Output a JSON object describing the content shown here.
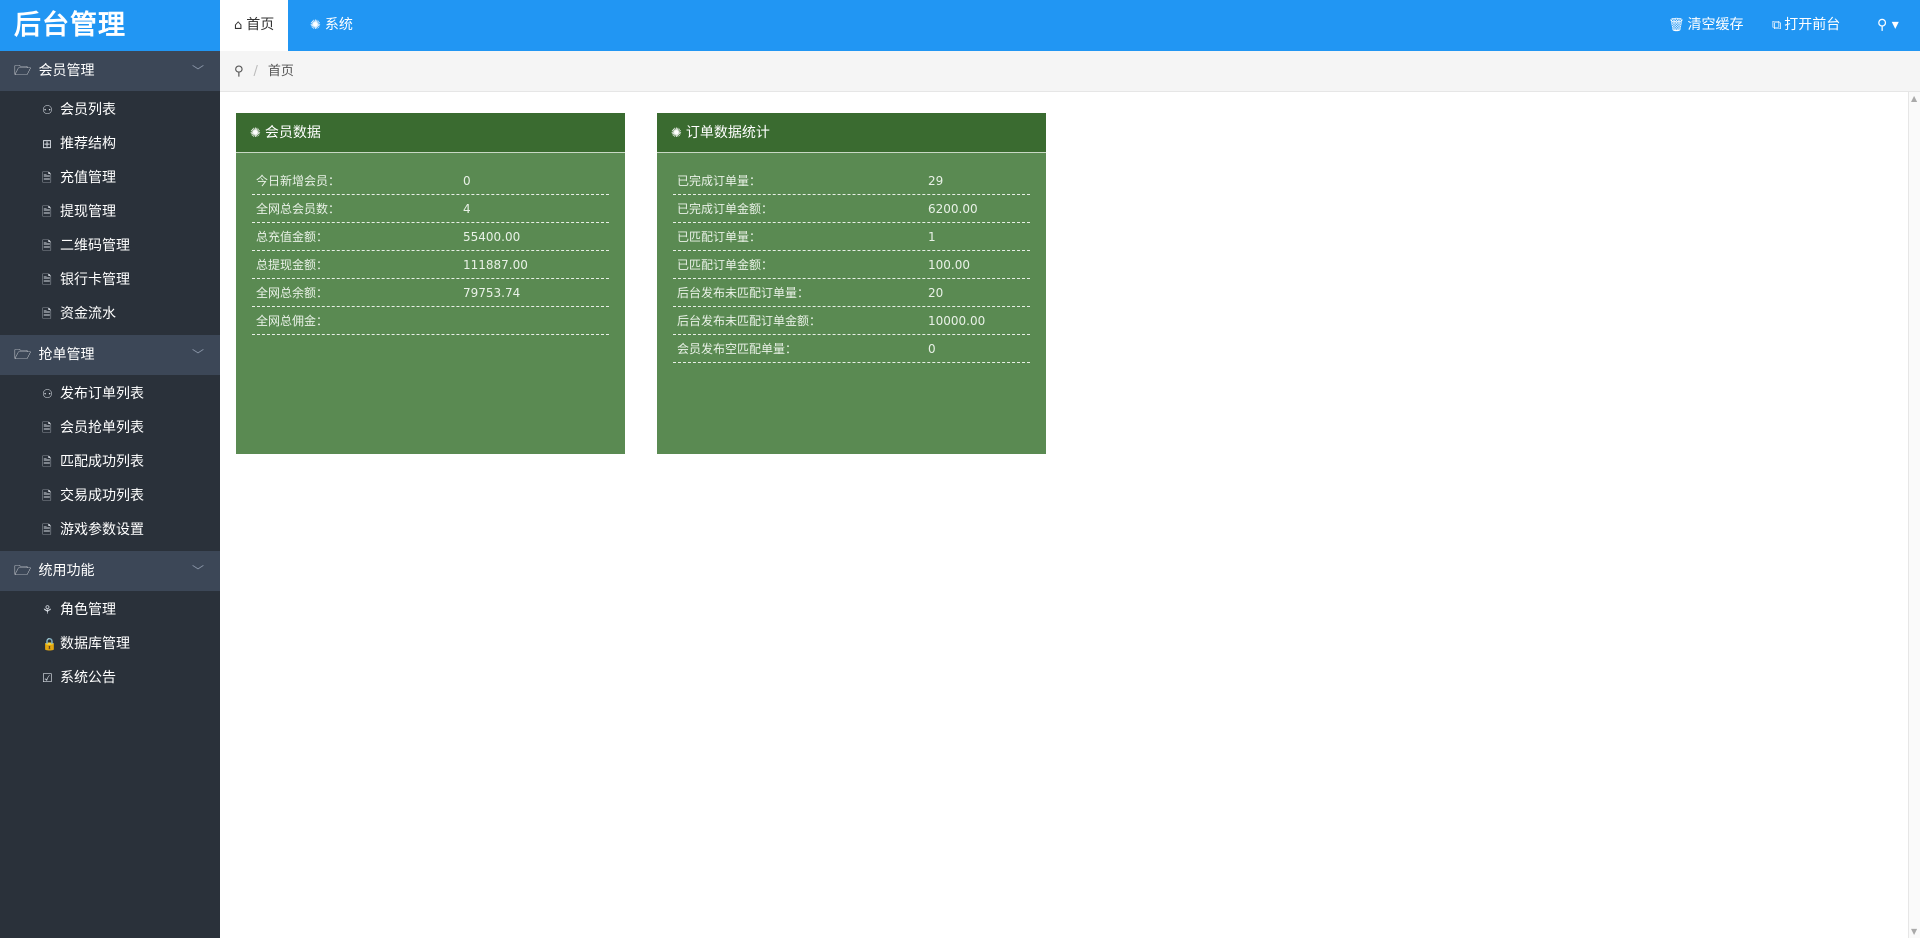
{
  "brand": "后台管理",
  "topbar": {
    "tabs": [
      {
        "icon": "home-icon",
        "glyph": "⌂",
        "label": "首页"
      },
      {
        "icon": "gear-icon",
        "glyph": "✺",
        "label": "系统"
      }
    ],
    "clear_cache": "清空缓存",
    "open_frontend": "打开前台",
    "user_glyph": "⚲ ▾"
  },
  "breadcrumb": {
    "icon": "location-icon",
    "glyph": "⚲",
    "separator": "/",
    "current": "首页"
  },
  "sidebar": {
    "groups": [
      {
        "title": "会员管理",
        "items": [
          {
            "label": "会员列表",
            "icon": "user-icon",
            "glyph": "⚇"
          },
          {
            "label": "推荐结构",
            "icon": "grid-icon",
            "glyph": "⊞"
          },
          {
            "label": "充值管理",
            "icon": "document-icon",
            "glyph": "🗎"
          },
          {
            "label": "提现管理",
            "icon": "document-icon",
            "glyph": "🗎"
          },
          {
            "label": "二维码管理",
            "icon": "document-icon",
            "glyph": "🗎"
          },
          {
            "label": "银行卡管理",
            "icon": "document-icon",
            "glyph": "🗎"
          },
          {
            "label": "资金流水",
            "icon": "document-icon",
            "glyph": "🗎"
          }
        ]
      },
      {
        "title": "抢单管理",
        "items": [
          {
            "label": "发布订单列表",
            "icon": "user-icon",
            "glyph": "⚇"
          },
          {
            "label": "会员抢单列表",
            "icon": "document-icon",
            "glyph": "🗎"
          },
          {
            "label": "匹配成功列表",
            "icon": "document-icon",
            "glyph": "🗎"
          },
          {
            "label": "交易成功列表",
            "icon": "document-icon",
            "glyph": "🗎"
          },
          {
            "label": "游戏参数设置",
            "icon": "document-icon",
            "glyph": "🗎"
          }
        ]
      },
      {
        "title": "统用功能",
        "items": [
          {
            "label": "角色管理",
            "icon": "users-icon",
            "glyph": "⚘"
          },
          {
            "label": "数据库管理",
            "icon": "lock-icon",
            "glyph": "🔒"
          },
          {
            "label": "系统公告",
            "icon": "chart-icon",
            "glyph": "☑"
          }
        ]
      }
    ]
  },
  "cards": [
    {
      "title": "会员数据",
      "rows": [
        {
          "label": "今日新增会员：",
          "value": "0"
        },
        {
          "label": "全网总会员数：",
          "value": "4"
        },
        {
          "label": "总充值金额：",
          "value": "55400.00"
        },
        {
          "label": "总提现金额：",
          "value": "111887.00"
        },
        {
          "label": "全网总余额：",
          "value": "79753.74"
        },
        {
          "label": "全网总佣金：",
          "value": ""
        }
      ]
    },
    {
      "title": "订单数据统计",
      "rows": [
        {
          "label": "已完成订单量：",
          "value": "29"
        },
        {
          "label": "已完成订单金额：",
          "value": "6200.00"
        },
        {
          "label": "已匹配订单量：",
          "value": "1"
        },
        {
          "label": "已匹配订单金额：",
          "value": "100.00"
        },
        {
          "label": "后台发布未匹配订单量：",
          "value": "20"
        },
        {
          "label": "后台发布未匹配订单金额：",
          "value": "10000.00"
        },
        {
          "label": "会员发布空匹配单量：",
          "value": "0"
        }
      ]
    }
  ],
  "colors": {
    "topbar": "#2196f3",
    "sidebar": "#2a313a",
    "sidebar_group": "#3c4757",
    "card": "#5a8a52",
    "card_head": "#3a6b30"
  }
}
